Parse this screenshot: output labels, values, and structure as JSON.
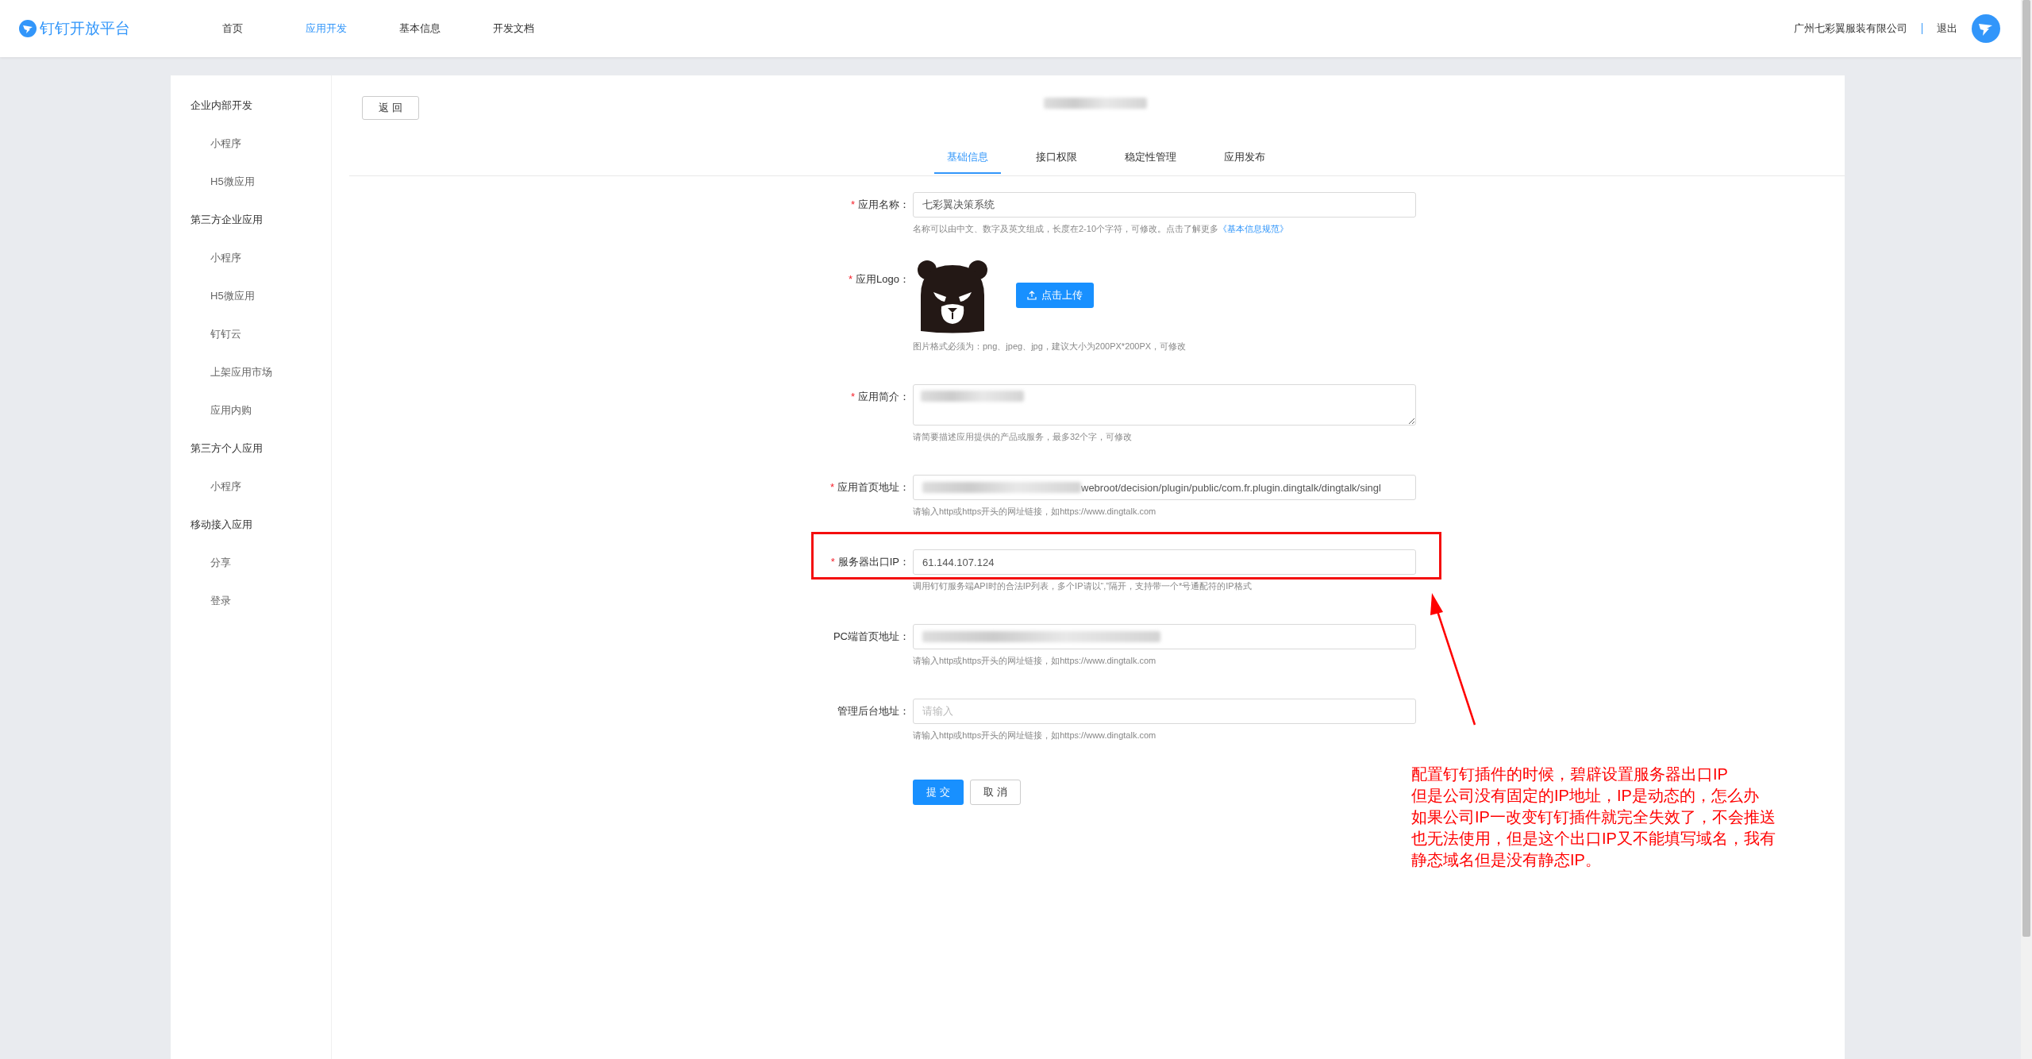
{
  "header": {
    "logo_text": "钉钉开放平台",
    "nav": [
      {
        "label": "首页",
        "selected": false
      },
      {
        "label": "应用开发",
        "selected": true
      },
      {
        "label": "基本信息",
        "selected": false
      },
      {
        "label": "开发文档",
        "selected": false
      }
    ],
    "company": "广州七彩翼服装有限公司",
    "logout": "退出"
  },
  "sidebar": {
    "groups": [
      {
        "label": "企业内部开发",
        "children": [
          {
            "label": "小程序"
          },
          {
            "label": "H5微应用"
          }
        ]
      },
      {
        "label": "第三方企业应用",
        "children": [
          {
            "label": "小程序"
          },
          {
            "label": "H5微应用"
          },
          {
            "label": "钉钉云"
          },
          {
            "label": "上架应用市场"
          },
          {
            "label": "应用内购"
          }
        ]
      },
      {
        "label": "第三方个人应用",
        "children": [
          {
            "label": "小程序"
          }
        ]
      },
      {
        "label": "移动接入应用",
        "children": [
          {
            "label": "分享"
          },
          {
            "label": "登录"
          }
        ]
      }
    ]
  },
  "back_button": "返 回",
  "tabs": [
    {
      "label": "基础信息",
      "selected": true
    },
    {
      "label": "接口权限",
      "selected": false
    },
    {
      "label": "稳定性管理",
      "selected": false
    },
    {
      "label": "应用发布",
      "selected": false
    }
  ],
  "form": {
    "fields": [
      {
        "kind": "input",
        "label": "应用名称：",
        "required_mark": "*",
        "value": "七彩翼决策系统",
        "hint": "名称可以由中文、数字及英文组成，长度在2-10个字符，可修改。点击了解更多",
        "hint_link": "《基本信息规范》"
      },
      {
        "kind": "logo",
        "label": "应用Logo：",
        "required_mark": "*",
        "upload_button": "点击上传",
        "hint": "图片格式必须为：png、jpeg、jpg，建议大小为200PX*200PX，可修改"
      },
      {
        "kind": "textarea",
        "label": "应用简介：",
        "required_mark": "*",
        "blurred": true,
        "hint": "请简要描述应用提供的产品或服务，最多32个字，可修改"
      },
      {
        "kind": "input",
        "label": "应用首页地址：",
        "required_mark": "*",
        "blurred": true,
        "value": "webroot/decision/plugin/public/com.fr.plugin.dingtalk/dingtalk/singl",
        "hint": "请输入http或https开头的网址链接，如https://www.dingtalk.com"
      },
      {
        "kind": "input",
        "label": "服务器出口IP：",
        "required_mark": "*",
        "highlighted": true,
        "value": "61.144.107.124",
        "hint": "调用钉钉服务端API时的合法IP列表，多个IP请以“,”隔开，支持带一个*号通配符的IP格式"
      },
      {
        "kind": "input",
        "label": "PC端首页地址：",
        "blurred": true,
        "hint": "请输入http或https开头的网址链接，如https://www.dingtalk.com"
      },
      {
        "kind": "input",
        "label": "管理后台地址：",
        "placeholder": "请输入",
        "hint": "请输入http或https开头的网址链接，如https://www.dingtalk.com"
      }
    ],
    "submit": "提 交",
    "cancel": "取 消"
  },
  "annotation": {
    "lines": [
      "配置钉钉插件的时候，碧辟设置服务器出口IP",
      "但是公司没有固定的IP地址，IP是动态的，怎么办",
      "如果公司IP一改变钉钉插件就完全失效了，不会推送",
      "也无法使用，但是这个出口IP又不能填写域名，我有",
      "静态域名但是没有静态IP。"
    ]
  }
}
